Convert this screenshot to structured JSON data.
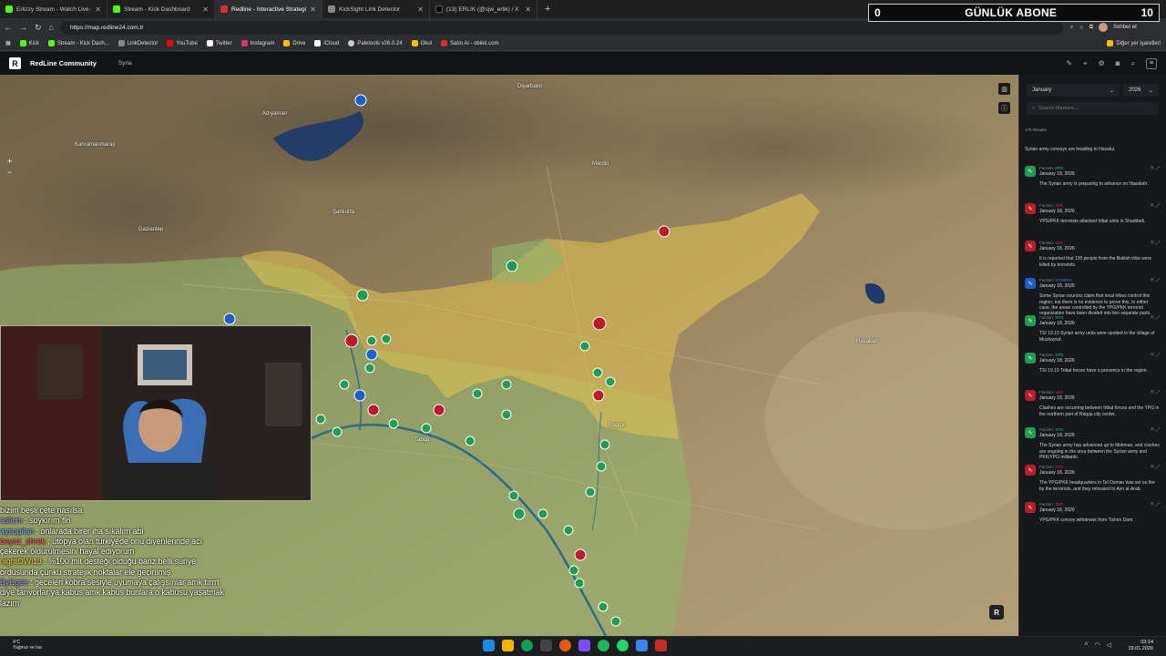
{
  "tabs": [
    {
      "title": "Erlizzy Stream - Watch Live on Kick",
      "color": "#53fc18"
    },
    {
      "title": "Stream - Kick Dashboard",
      "color": "#53fc18"
    },
    {
      "title": "Redline - Interactive Strategic Map",
      "color": "#d93025",
      "active": true
    },
    {
      "title": "KickSight Link Detector",
      "color": "#888888"
    },
    {
      "title": "(13) ERLIK (@sjw_erlik) / X",
      "color": "#000000"
    }
  ],
  "overlay": {
    "subscriber_count": "0",
    "subscriber_label": "GÜNLÜK ABONE",
    "right_count": "10"
  },
  "address": {
    "url": "https://map.redline24.com.tr",
    "chat_button": "Sohbet et"
  },
  "bookmarks": [
    {
      "label": "Kick",
      "color": "#53fc18"
    },
    {
      "label": "Stream - Kick Dash...",
      "color": "#53fc18"
    },
    {
      "label": "LinkDetector",
      "color": "#888"
    },
    {
      "label": "YouTube",
      "color": "#ff0000"
    },
    {
      "label": "Twitter",
      "color": "#ffffff"
    },
    {
      "label": "Instagram",
      "color": "#e1306c"
    },
    {
      "label": "Drive",
      "color": "#fbbc04"
    },
    {
      "label": "iCloud",
      "color": "#ffffff"
    },
    {
      "label": "Paletools v26.0.24",
      "color": "#cccccc"
    },
    {
      "label": "Okul",
      "color": "#fbbc04"
    },
    {
      "label": "Satın Al - obilet.com",
      "color": "#d93025"
    }
  ],
  "bookmarks_other": "Diğer yer işaretleri",
  "app": {
    "logo": "R",
    "name": "RedLine Community",
    "breadcrumb": "Syria"
  },
  "map_places": [
    {
      "name": "Diyarbakır"
    },
    {
      "name": "Adıyaman"
    },
    {
      "name": "Kahramanmaraş"
    },
    {
      "name": "Gaziantep"
    },
    {
      "name": "Şanlıurfa"
    },
    {
      "name": "Mardin"
    },
    {
      "name": "Hasakah"
    },
    {
      "name": "Raqqa"
    },
    {
      "name": "Tabqa"
    }
  ],
  "panel": {
    "month": "January",
    "year": "2026",
    "search_placeholder": "Search Markers...",
    "results": "178 Results",
    "first_desc": "Syrian army convoys are heading to Hasaka.",
    "items": [
      {
        "faction": "STG",
        "color": "#1f9d55",
        "date": "January 18, 2026",
        "desc": "The Syrian army is preparing to advance on Hasakah."
      },
      {
        "faction": "SDF",
        "color": "#b81d2a",
        "date": "January 18, 2026",
        "desc": "YPG/PKK terrorists attacked tribal units in Shaddadi."
      },
      {
        "faction": "SDF",
        "color": "#b81d2a",
        "date": "January 18, 2026",
        "desc": "It is reported that 120 people from the Bukish tribe were killed by terrorists."
      },
      {
        "faction": "OTHERS",
        "color": "#1c5fc9",
        "date": "January 18, 2026",
        "desc": "Some Syrian sources claim that local tribes control this region, but there is no evidence to prove this. In either case, the areas controlled by the YPG/PKK terrorist organization have been divided into two separate parts."
      },
      {
        "faction": "STG",
        "color": "#1f9d55",
        "date": "January 18, 2026",
        "desc": "TSI 19.10 Syrian army units were spotted in the village of Mushayraf."
      },
      {
        "faction": "STG",
        "color": "#1f9d55",
        "date": "January 18, 2026",
        "desc": "TSI 19.10 Tribal forces have a presence in the region."
      },
      {
        "faction": "SDF",
        "color": "#b81d2a",
        "date": "January 18, 2026",
        "desc": "Clashes are occurring between tribal forces and the YPG in the northern part of Raqqa city center."
      },
      {
        "faction": "STG",
        "color": "#1f9d55",
        "date": "January 18, 2026",
        "desc": "The Syrian army has advanced up to Mekman, and clashes are ongoing in the area between the Syrian army and PKK/YPG militants."
      },
      {
        "faction": "SDF",
        "color": "#b81d2a",
        "date": "January 18, 2026",
        "desc": "The YPG/PKK headquarters in Tel Osman was set on fire by the terrorists, and they retreated to Ayn al-Arab."
      },
      {
        "faction": "SDF",
        "color": "#b81d2a",
        "date": "January 18, 2026",
        "desc": "YPG/PKK convoy withdraws from Tishrin Dam."
      }
    ]
  },
  "chat": [
    {
      "user": "",
      "color": "#ffffff",
      "msg": "bizim beşli çete nasılsa"
    },
    {
      "user": "aslicm",
      "color": "#b58cff",
      "msg": " : soykırım fln"
    },
    {
      "user": "aysupilan",
      "color": "#6fb4ff",
      "msg": " : onlarada birer iha sıkalım abi"
    },
    {
      "user": "beyaz_shrek",
      "color": "#ff5c5c",
      "msg": " : ütopya olan türkiyede onu diyenlerinde acı"
    },
    {
      "user": "",
      "color": "#ffffff",
      "msg": "çekerek öldürülmesini hayal ediyorum"
    },
    {
      "user": "nightOWl13",
      "color": "#ffd84a",
      "msg": " : %100 mit desteği olduğu bariz belli suriye"
    },
    {
      "user": "",
      "color": "#ffffff",
      "msg": "ordusunda çünkü stratejik noktalar ele geçirilmiş"
    },
    {
      "user": "ByEgee",
      "color": "#b58cff",
      "msg": " : geceleri kobra sesiyle uyumaya çalışsınlar amk tırrrt"
    },
    {
      "user": "",
      "color": "#ffffff",
      "msg": "diye tarıyorlar ya kabus amk kabus bunlara o kabusu yaşatmak"
    },
    {
      "user": "",
      "color": "#ffffff",
      "msg": "lazım"
    }
  ],
  "taskbar": {
    "weather_temp": "4°C",
    "weather_desc": "Yağmur ve kar",
    "time": "03:14",
    "date": "19.01.2026"
  }
}
